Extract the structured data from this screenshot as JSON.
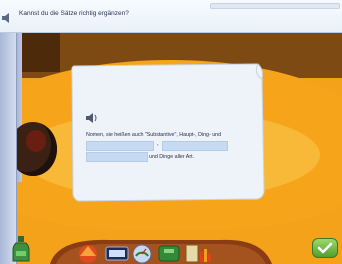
{
  "instruction": {
    "question": "Kannst du die Sätze richtig ergänzen?"
  },
  "exercise": {
    "sentence_part1": "Nomen, sie heißen auch \"Substantive\", Haupt-, Ding- und",
    "separator": ",",
    "sentence_part2": "und Dinge aller Art.",
    "blanks": [
      "",
      "",
      ""
    ]
  },
  "icons": {
    "top_speaker": "speaker-icon",
    "paper_speaker": "speaker-icon",
    "bottle": "bottle-icon",
    "ok": "checkmark-icon"
  },
  "colors": {
    "accent_orange": "#f3a21a",
    "blank_fill": "#c6daf2",
    "ok_green": "#4f9f2f"
  }
}
